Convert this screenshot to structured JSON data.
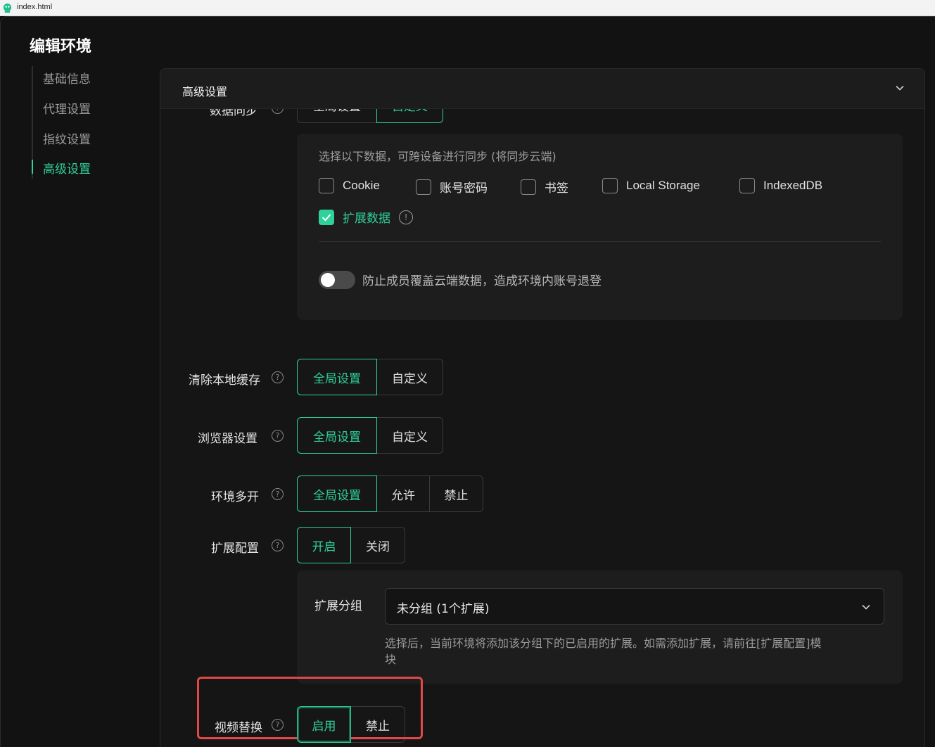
{
  "titlebar": {
    "title": "index.html"
  },
  "page": {
    "title": "编辑环境"
  },
  "nav": {
    "items": [
      {
        "label": "基础信息"
      },
      {
        "label": "代理设置"
      },
      {
        "label": "指纹设置"
      },
      {
        "label": "高级设置"
      }
    ]
  },
  "panel": {
    "title": "高级设置"
  },
  "data_sync": {
    "label": "数据同步",
    "options": [
      "全局设置",
      "自定义"
    ],
    "selected": "自定义",
    "hint": "选择以下数据，可跨设备进行同步 (将同步云端)",
    "checkboxes": [
      {
        "label": "Cookie",
        "checked": false
      },
      {
        "label": "账号密码",
        "checked": false
      },
      {
        "label": "书签",
        "checked": false
      },
      {
        "label": "Local Storage",
        "checked": false
      },
      {
        "label": "IndexedDB",
        "checked": false
      },
      {
        "label": "扩展数据",
        "checked": true
      }
    ],
    "toggle_label": "防止成员覆盖云端数据，造成环境内账号退登",
    "toggle_on": false
  },
  "clear_cache": {
    "label": "清除本地缓存",
    "options": [
      "全局设置",
      "自定义"
    ],
    "selected": "全局设置"
  },
  "browser_settings": {
    "label": "浏览器设置",
    "options": [
      "全局设置",
      "自定义"
    ],
    "selected": "全局设置"
  },
  "multi_open": {
    "label": "环境多开",
    "options": [
      "全局设置",
      "允许",
      "禁止"
    ],
    "selected": "全局设置"
  },
  "extension_config": {
    "label": "扩展配置",
    "options": [
      "开启",
      "关闭"
    ],
    "selected": "开启",
    "group_label": "扩展分组",
    "group_value": "未分组 (1个扩展)",
    "group_hint_line1": "选择后，当前环境将添加该分组下的已启用的扩展。如需添加扩展，请前往[扩展配置]模",
    "group_hint_line2": "块"
  },
  "video_replace": {
    "label": "视频替换",
    "options": [
      "启用",
      "禁止"
    ],
    "selected": "启用"
  },
  "colors": {
    "accent": "#2fd19a",
    "highlight": "#e04848",
    "background": "#121212"
  }
}
